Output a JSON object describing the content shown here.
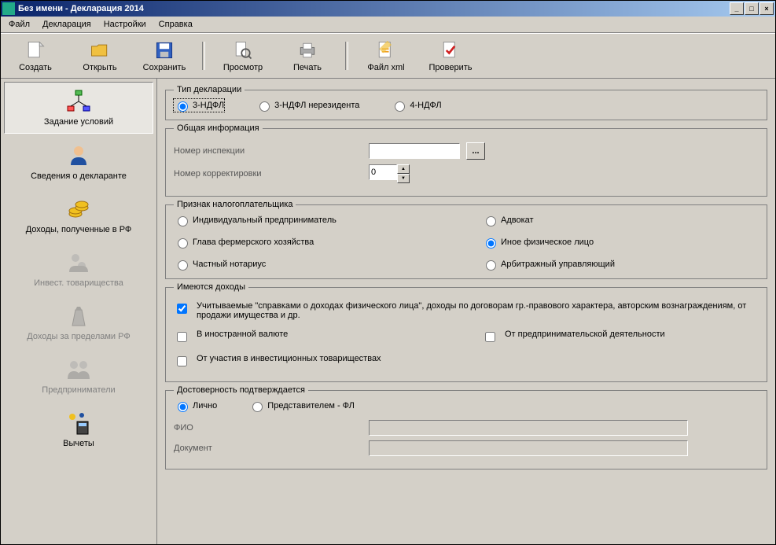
{
  "window": {
    "title": "Без имени - Декларация 2014"
  },
  "menu": {
    "file": "Файл",
    "declaration": "Декларация",
    "settings": "Настройки",
    "help": "Справка"
  },
  "toolbar": {
    "create": "Создать",
    "open": "Открыть",
    "save": "Сохранить",
    "preview": "Просмотр",
    "print": "Печать",
    "xml": "Файл xml",
    "check": "Проверить"
  },
  "sidebar": {
    "conditions": "Задание условий",
    "declarant": "Сведения о декларанте",
    "income_rf": "Доходы, полученные в РФ",
    "invest": "Инвест. товарищества",
    "income_foreign": "Доходы за пределами РФ",
    "entrepreneurs": "Предприниматели",
    "deductions": "Вычеты"
  },
  "groups": {
    "decl_type": "Тип декларации",
    "general": "Общая информация",
    "taxpayer": "Признак налогоплательщика",
    "has_income": "Имеются доходы",
    "confirm": "Достоверность подтверждается"
  },
  "decl_type": {
    "ndfl3": "3-НДФЛ",
    "ndfl3nr": "3-НДФЛ нерезидента",
    "ndfl4": "4-НДФЛ"
  },
  "general": {
    "inspection": "Номер инспекции",
    "inspection_val": "",
    "correction": "Номер корректировки",
    "correction_val": "0",
    "browse": "..."
  },
  "taxpayer": {
    "ip": "Индивидуальный предприниматель",
    "farm": "Глава фермерского хозяйства",
    "notary": "Частный нотариус",
    "lawyer": "Адвокат",
    "other": "Иное физическое лицо",
    "arbitr": "Арбитражный управляющий"
  },
  "income": {
    "cert": "Учитываемые \"справками о доходах физического лица\", доходы по договорам гр.-правового характера, авторским вознаграждениям, от продажи имущества и др.",
    "foreign": "В иностранной валюте",
    "biz": "От предпринимательской деятельности",
    "invest": "От участия в инвестиционных товариществах"
  },
  "confirm": {
    "self": "Лично",
    "rep": "Представителем - ФЛ",
    "fio": "ФИО",
    "doc": "Документ"
  }
}
